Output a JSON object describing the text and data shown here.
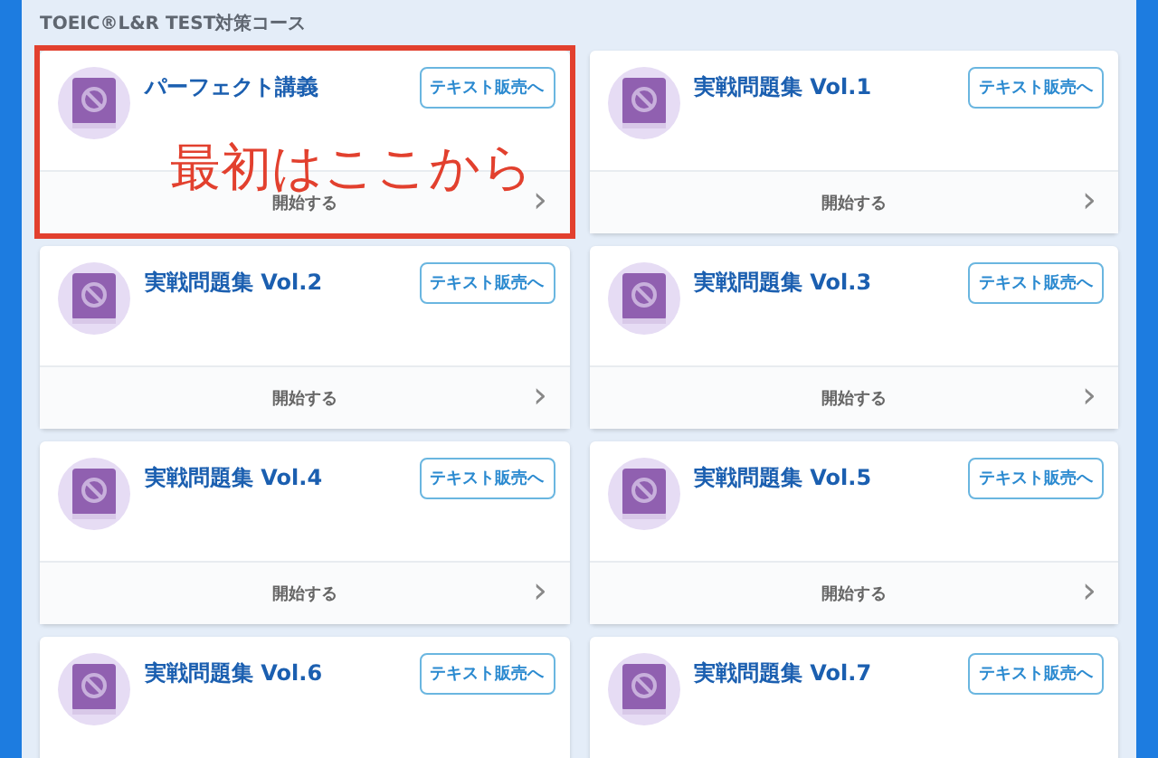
{
  "section_title": "TOEIC®L&R TEST対策コース",
  "courses": [
    {
      "title": "パーフェクト講義",
      "shop_button": "テキスト販売へ",
      "start_label": "開始する",
      "chevron": "›",
      "annotation": "最初はここから"
    },
    {
      "title": "実戦問題集 Vol.1",
      "shop_button": "テキスト販売へ",
      "start_label": "開始する",
      "chevron": "›"
    },
    {
      "title": "実戦問題集 Vol.2",
      "shop_button": "テキスト販売へ",
      "start_label": "開始する",
      "chevron": "›"
    },
    {
      "title": "実戦問題集 Vol.3",
      "shop_button": "テキスト販売へ",
      "start_label": "開始する",
      "chevron": "›"
    },
    {
      "title": "実戦問題集 Vol.4",
      "shop_button": "テキスト販売へ",
      "start_label": "開始する",
      "chevron": "›"
    },
    {
      "title": "実戦問題集 Vol.5",
      "shop_button": "テキスト販売へ",
      "start_label": "開始する",
      "chevron": "›"
    },
    {
      "title": "実戦問題集 Vol.6",
      "shop_button": "テキスト販売へ"
    },
    {
      "title": "実戦問題集 Vol.7",
      "shop_button": "テキスト販売へ"
    }
  ]
}
